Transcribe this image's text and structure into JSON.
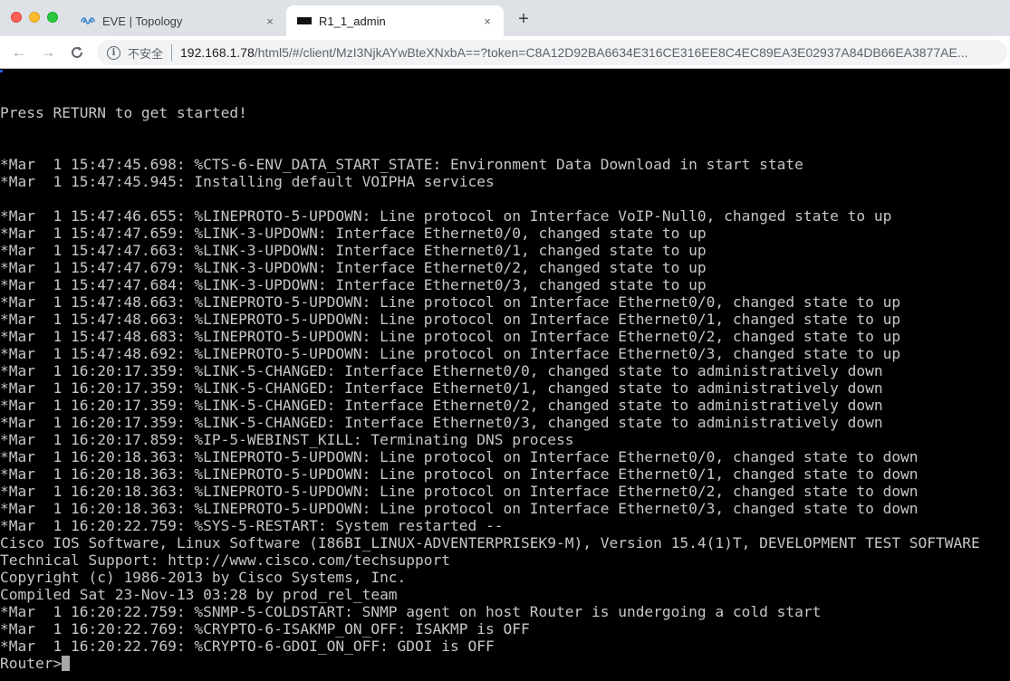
{
  "browser": {
    "tabs": [
      {
        "title": "EVE | Topology",
        "favicon": "eve-logo-icon",
        "active": false
      },
      {
        "title": "R1_1_admin",
        "favicon": "terminal-icon",
        "active": true
      }
    ],
    "new_tab_label": "+",
    "close_label": "×",
    "nav": {
      "back": "←",
      "forward": "→",
      "reload": "C"
    },
    "address": {
      "security_label": "不安全",
      "host": "192.168.1.78",
      "path": "/html5/#/client/MzI3NjkAYwBteXNxbA==?token=C8A12D92BA6634E316CE316EE8C4EC89EA3E02937A84DB66EA3877AE..."
    }
  },
  "terminal": {
    "lines": [
      "Press RETURN to get started!",
      "",
      "",
      "*Mar  1 15:47:45.698: %CTS-6-ENV_DATA_START_STATE: Environment Data Download in start state",
      "*Mar  1 15:47:45.945: Installing default VOIPHA services",
      "",
      "*Mar  1 15:47:46.655: %LINEPROTO-5-UPDOWN: Line protocol on Interface VoIP-Null0, changed state to up",
      "*Mar  1 15:47:47.659: %LINK-3-UPDOWN: Interface Ethernet0/0, changed state to up",
      "*Mar  1 15:47:47.663: %LINK-3-UPDOWN: Interface Ethernet0/1, changed state to up",
      "*Mar  1 15:47:47.679: %LINK-3-UPDOWN: Interface Ethernet0/2, changed state to up",
      "*Mar  1 15:47:47.684: %LINK-3-UPDOWN: Interface Ethernet0/3, changed state to up",
      "*Mar  1 15:47:48.663: %LINEPROTO-5-UPDOWN: Line protocol on Interface Ethernet0/0, changed state to up",
      "*Mar  1 15:47:48.663: %LINEPROTO-5-UPDOWN: Line protocol on Interface Ethernet0/1, changed state to up",
      "*Mar  1 15:47:48.683: %LINEPROTO-5-UPDOWN: Line protocol on Interface Ethernet0/2, changed state to up",
      "*Mar  1 15:47:48.692: %LINEPROTO-5-UPDOWN: Line protocol on Interface Ethernet0/3, changed state to up",
      "*Mar  1 16:20:17.359: %LINK-5-CHANGED: Interface Ethernet0/0, changed state to administratively down",
      "*Mar  1 16:20:17.359: %LINK-5-CHANGED: Interface Ethernet0/1, changed state to administratively down",
      "*Mar  1 16:20:17.359: %LINK-5-CHANGED: Interface Ethernet0/2, changed state to administratively down",
      "*Mar  1 16:20:17.359: %LINK-5-CHANGED: Interface Ethernet0/3, changed state to administratively down",
      "*Mar  1 16:20:17.859: %IP-5-WEBINST_KILL: Terminating DNS process",
      "*Mar  1 16:20:18.363: %LINEPROTO-5-UPDOWN: Line protocol on Interface Ethernet0/0, changed state to down",
      "*Mar  1 16:20:18.363: %LINEPROTO-5-UPDOWN: Line protocol on Interface Ethernet0/1, changed state to down",
      "*Mar  1 16:20:18.363: %LINEPROTO-5-UPDOWN: Line protocol on Interface Ethernet0/2, changed state to down",
      "*Mar  1 16:20:18.363: %LINEPROTO-5-UPDOWN: Line protocol on Interface Ethernet0/3, changed state to down",
      "*Mar  1 16:20:22.759: %SYS-5-RESTART: System restarted --",
      "Cisco IOS Software, Linux Software (I86BI_LINUX-ADVENTERPRISEK9-M), Version 15.4(1)T, DEVELOPMENT TEST SOFTWARE",
      "Technical Support: http://www.cisco.com/techsupport",
      "Copyright (c) 1986-2013 by Cisco Systems, Inc.",
      "Compiled Sat 23-Nov-13 03:28 by prod_rel_team",
      "*Mar  1 16:20:22.759: %SNMP-5-COLDSTART: SNMP agent on host Router is undergoing a cold start",
      "*Mar  1 16:20:22.769: %CRYPTO-6-ISAKMP_ON_OFF: ISAKMP is OFF",
      "*Mar  1 16:20:22.769: %CRYPTO-6-GDOI_ON_OFF: GDOI is OFF"
    ],
    "prompt": "Router>",
    "input": ""
  }
}
